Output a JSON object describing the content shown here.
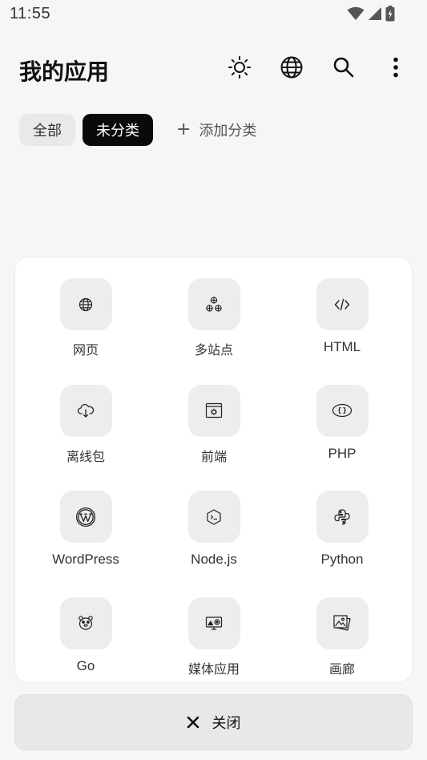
{
  "status": {
    "time": "11:55"
  },
  "header": {
    "title": "我的应用"
  },
  "chips": {
    "all": "全部",
    "uncategorized": "未分类",
    "add": "添加分类"
  },
  "apps": [
    {
      "label": "网页",
      "icon": "globe-icon"
    },
    {
      "label": "多站点",
      "icon": "multi-globe-icon"
    },
    {
      "label": "HTML",
      "icon": "code-icon"
    },
    {
      "label": "离线包",
      "icon": "cloud-download-icon"
    },
    {
      "label": "前端",
      "icon": "browser-window-icon"
    },
    {
      "label": "PHP",
      "icon": "php-icon"
    },
    {
      "label": "WordPress",
      "icon": "wordpress-icon"
    },
    {
      "label": "Node.js",
      "icon": "nodejs-icon"
    },
    {
      "label": "Python",
      "icon": "python-icon"
    },
    {
      "label": "Go",
      "icon": "gopher-icon"
    },
    {
      "label": "媒体应用",
      "icon": "media-icon"
    },
    {
      "label": "画廊",
      "icon": "gallery-icon"
    }
  ],
  "footer": {
    "close": "关闭"
  }
}
